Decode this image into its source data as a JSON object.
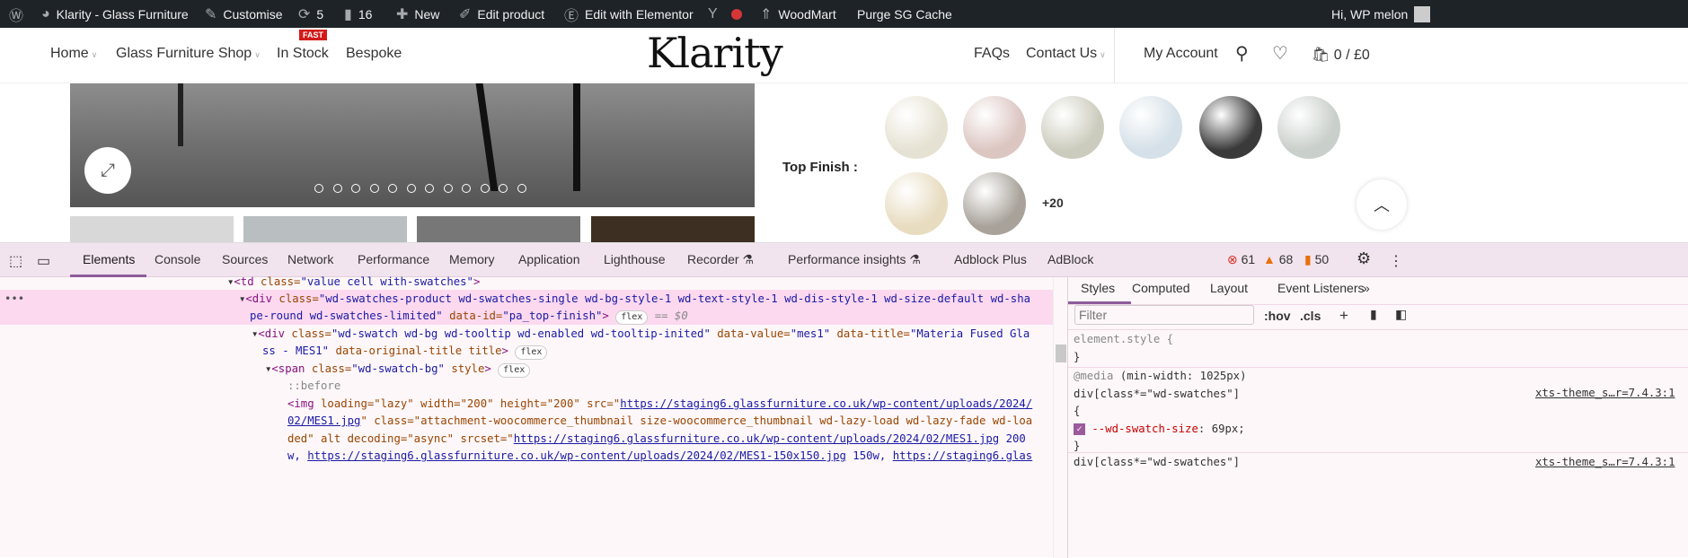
{
  "admin_bar": {
    "site": "Klarity - Glass Furniture",
    "customise": "Customise",
    "updates": "5",
    "comments": "16",
    "new": "New",
    "edit_product": "Edit product",
    "elementor": "Edit with Elementor",
    "woodmart": "WoodMart",
    "purge": "Purge SG Cache",
    "greeting": "Hi, WP melon"
  },
  "header": {
    "nav_left": [
      "Home",
      "Glass Furniture Shop",
      "In Stock",
      "Bespoke"
    ],
    "badge": "FAST",
    "logo": "Klarity",
    "nav_right": [
      "FAQs",
      "Contact Us"
    ],
    "account": "My Account",
    "cart": "0 / £0"
  },
  "product": {
    "finish_label": "Top Finish :",
    "more_swatches": "+20",
    "swatch_colors": [
      "#e6e2d3",
      "#dcc6c2",
      "#ccccbe",
      "#d5e0e8",
      "#3a3a3a",
      "#c9cfcb",
      "#e8dcc0",
      "#a8a29a"
    ],
    "slider_dots": 12
  },
  "devtools": {
    "tabs": [
      "Elements",
      "Console",
      "Sources",
      "Network",
      "Performance",
      "Memory",
      "Application",
      "Lighthouse",
      "Recorder",
      "Performance insights",
      "Adblock Plus",
      "AdBlock"
    ],
    "errors": "61",
    "warnings": "68",
    "issues": "50",
    "code": {
      "l1_tag": "<td",
      "l1_a": " class=",
      "l1_v": "\"value cell with-swatches\"",
      "l1_end": ">",
      "l2_a1": " class=",
      "l2_v1": "\"wd-swatches-product wd-swatches-single wd-bg-style-1 wd-text-style-1 wd-dis-style-1 wd-size-default wd-sha",
      "l2b_v1": "pe-round wd-swatches-limited\"",
      "l2_a2": " data-id=",
      "l2_v2": "\"pa_top-finish\"",
      "l2_sel": "== $0",
      "l3_a1": " class=",
      "l3_v1": "\"wd-swatch wd-bg wd-tooltip wd-enabled wd-tooltip-inited\"",
      "l3_a2": " data-value=",
      "l3_v2": "\"mes1\"",
      "l3_a3": " data-title=",
      "l3_v3": "\"Materia Fused Gla",
      "l3b_v3": "ss - MES1\"",
      "l3_a4": " data-original-title title",
      "l4_a": " class=",
      "l4_v": "\"wd-swatch-bg\"",
      "l4_a2": " style",
      "pseudo": "::before",
      "img1": " loading=\"lazy\" width=\"200\" height=\"200\" src=\"",
      "url1": "https://staging6.glassfurniture.co.uk/wp-content/uploads/2024/",
      "url1b": "02/MES1.jpg",
      "img2": "\" class=\"attachment-woocommerce_thumbnail size-woocommerce_thumbnail wd-lazy-load wd-lazy-fade wd-loa",
      "img3": "ded\" alt decoding=\"async\" srcset=\"",
      "url2": "https://staging6.glassfurniture.co.uk/wp-content/uploads/2024/02/MES1.jpg",
      "img3b": " 200",
      "img4": "w, ",
      "url3": "https://staging6.glassfurniture.co.uk/wp-content/uploads/2024/02/MES1-150x150.jpg",
      "img4b": " 150w, ",
      "url4": "https://staging6.glas",
      "flex": "flex",
      "div": "<div",
      "span": "<span",
      "img": "<img"
    },
    "styles": {
      "tabs": [
        "Styles",
        "Computed",
        "Layout",
        "Event Listeners"
      ],
      "filter_placeholder": "Filter",
      "hov": ":hov",
      "cls": ".cls",
      "element_style": "element.style {",
      "close": "}",
      "media": "@media",
      "media_q": " (min-width: 1025px)",
      "selector": "div[class*=\"wd-swatches\"]",
      "open": "{",
      "source": "xts-theme_s…r=7.4.3:1",
      "prop": "--wd-swatch-size",
      "val": "69px;"
    }
  }
}
